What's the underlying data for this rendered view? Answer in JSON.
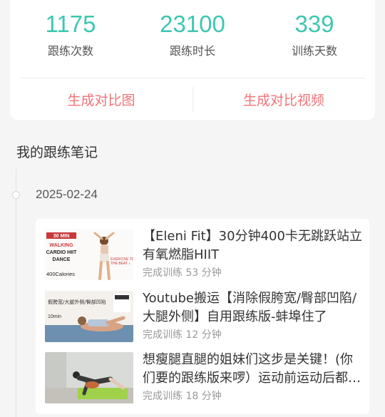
{
  "stats": [
    {
      "value": "1175",
      "label": "跟练次数"
    },
    {
      "value": "23100",
      "label": "跟练时长"
    },
    {
      "value": "339",
      "label": "训练天数"
    }
  ],
  "actions": {
    "compare_image": "生成对比图",
    "compare_video": "生成对比视频"
  },
  "colors": {
    "accent_teal": "#3dc7b0",
    "accent_red": "#f07378"
  },
  "notes_section": {
    "title": "我的跟练笔记",
    "date": "2025-02-24",
    "items": [
      {
        "title": "【Eleni Fit】30分钟400卡无跳跃站立有氧燃脂HIIT",
        "subtitle": "完成训练 53 分钟",
        "thumb": {
          "badge": "30 MIN",
          "line1": "WALKING",
          "line2": "CARDIO HIIT",
          "line3": "DANCE",
          "calories": "400Calories",
          "side": "EXERCISE TO THE BEAT"
        }
      },
      {
        "title": "Youtube搬运【消除假胯宽/臀部凹陷/大腿外侧】自用跟练版-蚌埠住了",
        "subtitle": "完成训练 12 分钟",
        "thumb": {
          "line1": "假胯宽/大腿外侧/臀部凹陷",
          "duration": "10min"
        }
      },
      {
        "title": "想瘦腿直腿的姐妹们这步是关键！(你们要的跟练版来啰）运动前运动后都可以做",
        "subtitle": "完成训练 18 分钟",
        "thumb": {}
      }
    ]
  }
}
